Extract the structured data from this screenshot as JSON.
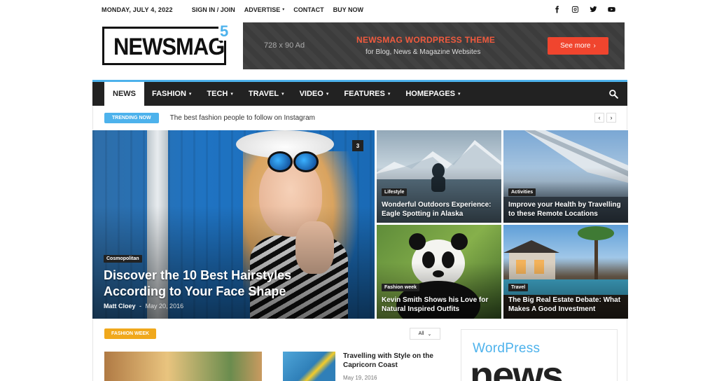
{
  "topbar": {
    "date": "MONDAY, JULY 4, 2022",
    "links": [
      {
        "label": "SIGN IN / JOIN",
        "caret": false
      },
      {
        "label": "ADVERTISE",
        "caret": true
      },
      {
        "label": "CONTACT",
        "caret": false
      },
      {
        "label": "BUY NOW",
        "caret": false
      }
    ],
    "socials": [
      "facebook-icon",
      "instagram-icon",
      "twitter-icon",
      "youtube-icon"
    ]
  },
  "logo": {
    "text": "NEWSMAG",
    "version": "5"
  },
  "ad": {
    "size": "728 x 90 Ad",
    "title": "NEWSMAG WORDPRESS THEME",
    "subtitle": "for Blog, News & Magazine Websites",
    "button": "See more",
    "button_icon": "›"
  },
  "nav": {
    "items": [
      {
        "label": "NEWS",
        "caret": false
      },
      {
        "label": "FASHION",
        "caret": true
      },
      {
        "label": "TECH",
        "caret": true
      },
      {
        "label": "TRAVEL",
        "caret": true
      },
      {
        "label": "VIDEO",
        "caret": true
      },
      {
        "label": "FEATURES",
        "caret": true
      },
      {
        "label": "HOMEPAGES",
        "caret": true
      }
    ],
    "caret": "▾",
    "search_icon": "search-icon"
  },
  "trending": {
    "badge": "TRENDING NOW",
    "headline": "The best fashion people to follow on Instagram",
    "prev": "‹",
    "next": "›"
  },
  "featured": {
    "category": "Cosmopolitan",
    "title_line1": "Discover the 10 Best Hairstyles",
    "title_line2": "According to Your Face Shape",
    "author": "Matt Cloey",
    "separator": "-",
    "date": "May 20, 2016",
    "comments": "3"
  },
  "tiles": [
    {
      "category": "Lifestyle",
      "line1": "Wonderful Outdoors Experience:",
      "line2": "Eagle Spotting in Alaska"
    },
    {
      "category": "Activities",
      "line1": "Improve your Health by Travelling",
      "line2": "to these Remote Locations"
    },
    {
      "category": "Fashion week",
      "line1": "Kevin Smith Shows his Love for",
      "line2": "Natural Inspired Outfits"
    },
    {
      "category": "Travel",
      "line1": "The Big Real Estate Debate: What",
      "line2": "Makes A Good Investment"
    }
  ],
  "section": {
    "badge": "FASHION WEEK",
    "filter": "All",
    "filter_icon": "⌄",
    "article_title": "Travelling with Style on the Capricorn Coast",
    "article_date": "May 19, 2016",
    "widget_line1": "WordPress",
    "widget_line2": "news"
  },
  "colors": {
    "accent": "#4db2ec",
    "ad_title": "#f05a3e",
    "ad_button": "#f0452e",
    "section_badge": "#f0a81c",
    "nav_bg": "#222222"
  }
}
